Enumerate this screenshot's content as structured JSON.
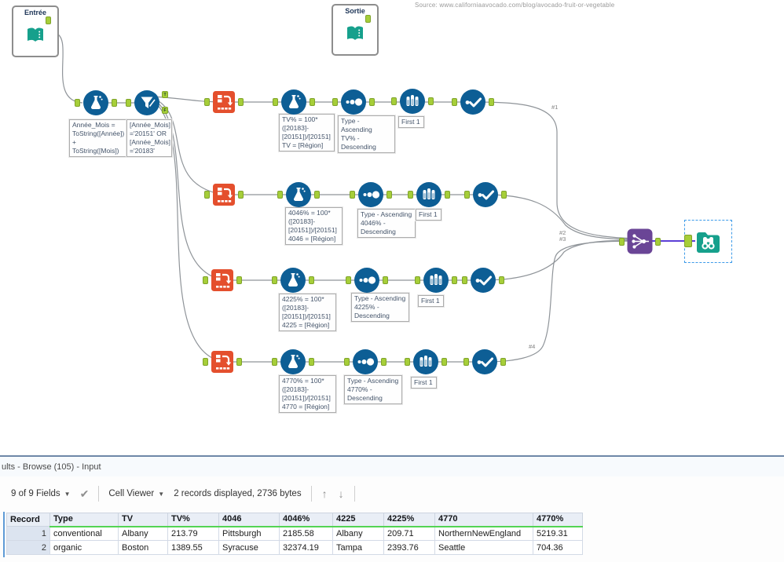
{
  "source_note": "Source: www.californiaavocado.com/blog/avocado-fruit-or-vegetable",
  "canvas": {
    "containers": {
      "input_title": "Entrée",
      "output_title": "Sortie"
    },
    "prep": {
      "formula_annotation": "Année_Mois =\nToString([Année])\n+ ToString([Mois])",
      "filter_annotation": "[Année_Mois]\n='20151' OR\n[Année_Mois]\n='20183'",
      "filter_true_label": "T",
      "filter_false_label": "F"
    },
    "branches": [
      {
        "formula": "TV% = 100*\n([20183]-\n[20151])/[20151]\nTV = [Région]",
        "sort": "Type - Ascending\nTV% -\nDescending",
        "sample": "First 1",
        "wire_label": "#1"
      },
      {
        "formula": "4046% = 100*\n([20183]-\n[20151])/[20151]\n4046 = [Région]",
        "sort": "Type - Ascending\n4046% -\nDescending",
        "sample": "First 1",
        "wire_label": "#2"
      },
      {
        "formula": "4225% = 100*\n([20183]-\n[20151])/[20151]\n4225 = [Région]",
        "sort": "Type - Ascending\n4225% -\nDescending",
        "sample": "First 1",
        "wire_label": "#3"
      },
      {
        "formula": "4770% = 100*\n([20183]-\n[20151])/[20151]\n4770 = [Région]",
        "sort": "Type - Ascending\n4770% -\nDescending",
        "sample": "First 1",
        "wire_label": "#4"
      }
    ]
  },
  "results_panel": {
    "title": "ults - Browse (105) - Input",
    "toolbar": {
      "fields_label": "9 of 9 Fields",
      "cell_viewer_label": "Cell Viewer",
      "records_label": "2 records displayed, 2736 bytes"
    },
    "table": {
      "columns": [
        "Record",
        "Type",
        "TV",
        "TV%",
        "4046",
        "4046%",
        "4225",
        "4225%",
        "4770",
        "4770%"
      ],
      "rows": [
        [
          "1",
          "conventional",
          "Albany",
          "213.79",
          "Pittsburgh",
          "2185.58",
          "Albany",
          "209.71",
          "NorthernNewEngland",
          "5219.31"
        ],
        [
          "2",
          "organic",
          "Boston",
          "1389.55",
          "Syracuse",
          "32374.19",
          "Tampa",
          "2393.76",
          "Seattle",
          "704.36"
        ]
      ]
    }
  },
  "colors": {
    "tool_blue": "#0d5e95",
    "tool_orange": "#e44f2d",
    "tool_purple": "#6a4596",
    "tool_teal": "#16a08c",
    "anchor_green": "#a6ce39",
    "wire_gray": "#8f9499",
    "union_wire_purple": "#5b3fd6",
    "selection_blue": "#3d9be9",
    "header_underline_green": "#53d453"
  }
}
